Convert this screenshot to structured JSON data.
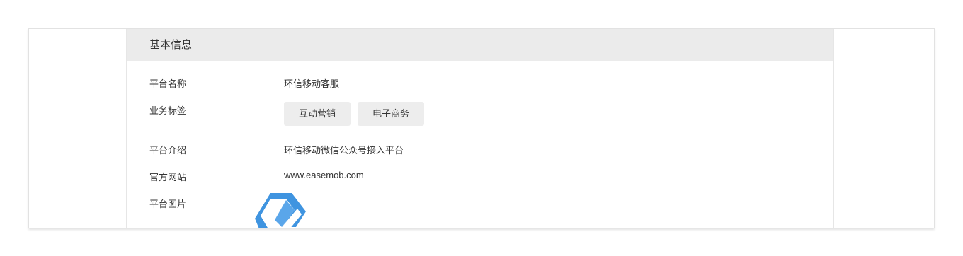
{
  "section": {
    "title": "基本信息"
  },
  "fields": {
    "platform_name": {
      "label": "平台名称",
      "value": "环信移动客服"
    },
    "business_tags": {
      "label": "业务标签",
      "tags": [
        "互动营销",
        "电子商务"
      ]
    },
    "platform_intro": {
      "label": "平台介绍",
      "value": "环信移动微信公众号接入平台"
    },
    "website": {
      "label": "官方网站",
      "value": "www.easemob.com"
    },
    "platform_image": {
      "label": "平台图片",
      "icon": "easemob-logo"
    }
  },
  "colors": {
    "header_bg": "#ebebeb",
    "tag_bg": "#ededed",
    "logo_blue": "#3f94e0"
  }
}
